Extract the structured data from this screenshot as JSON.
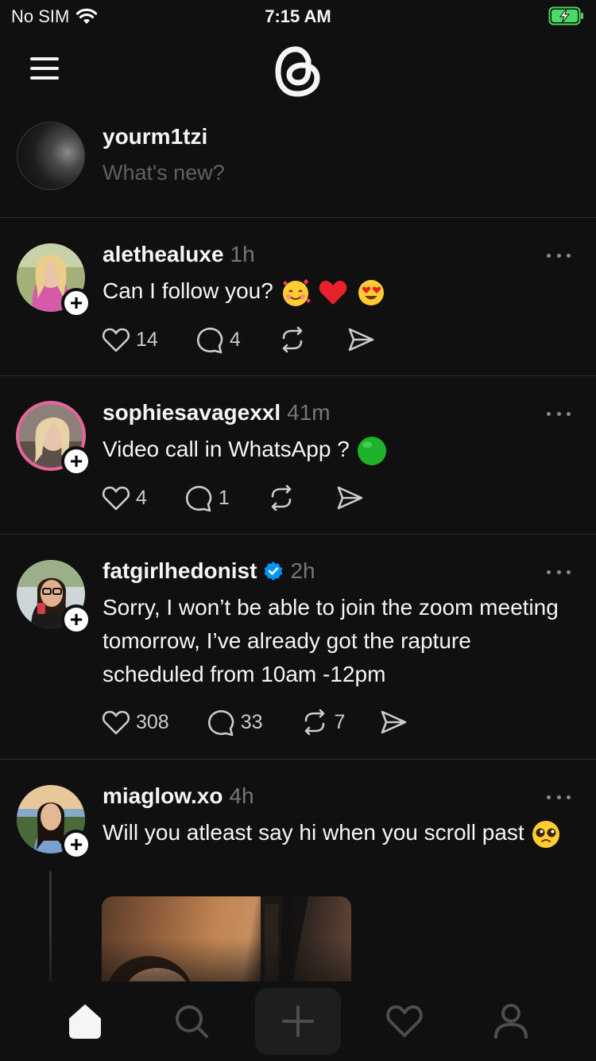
{
  "status": {
    "carrier": "No SIM",
    "time": "7:15 AM"
  },
  "composer": {
    "username": "yourm1tzi",
    "placeholder": "What's new?"
  },
  "posts": [
    {
      "username": "alethealuxe",
      "time": "1h",
      "text": "Can I follow you?",
      "likes": "14",
      "replies": "4",
      "reposts": "",
      "emojis": [
        "smiling-face-with-hearts",
        "red-heart",
        "heart-eyes"
      ]
    },
    {
      "username": "sophiesavagexxl",
      "time": "41m",
      "text": "Video call in WhatsApp ?",
      "likes": "4",
      "replies": "1",
      "reposts": "",
      "emojis": [
        "green-circle"
      ]
    },
    {
      "username": "fatgirlhedonist",
      "time": "2h",
      "verified": true,
      "text": "Sorry, I won’t be able to join the zoom meeting tomorrow, I’ve already got the rapture scheduled from 10am -12pm",
      "likes": "308",
      "replies": "33",
      "reposts": "7"
    },
    {
      "username": "miaglow.xo",
      "time": "4h",
      "text": "Will you atleast say hi when you scroll past",
      "likes": "",
      "replies": "",
      "reposts": "",
      "emojis": [
        "pleading-face"
      ]
    }
  ],
  "colors": {
    "background": "#101010",
    "verified": "#0095f6",
    "ring": "#e4669c",
    "battery": "#4cd964"
  },
  "tabs": [
    "home-icon",
    "search-icon",
    "new-post-icon",
    "activity-heart-icon",
    "profile-icon"
  ]
}
